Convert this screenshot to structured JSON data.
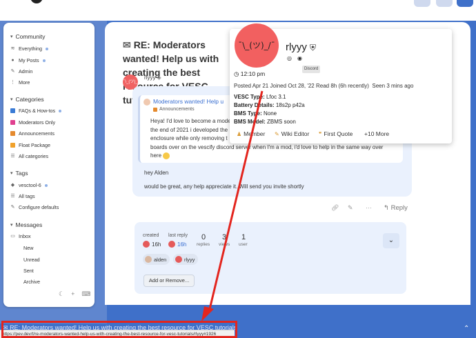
{
  "sidebar": {
    "community": {
      "heading": "Community",
      "items": [
        {
          "label": "Everything",
          "icon": "layers-icon",
          "dot": true
        },
        {
          "label": "My Posts",
          "icon": "user-icon",
          "dot": true
        },
        {
          "label": "Admin",
          "icon": "wrench-icon",
          "dot": false
        },
        {
          "label": "More",
          "icon": "ellipsis-icon",
          "dot": false
        }
      ]
    },
    "categories": {
      "heading": "Categories",
      "items": [
        {
          "label": "FAQs & How-tos",
          "color": "#3a7bd5",
          "dot": true
        },
        {
          "label": "Moderators Only",
          "color": "#e0408f",
          "dot": false
        },
        {
          "label": "Announcements",
          "color": "#e58a2e",
          "dot": false
        },
        {
          "label": "Float Package",
          "color": "#f0a12b",
          "dot": false
        },
        {
          "label": "All categories",
          "icon": "list-icon",
          "dot": false
        }
      ]
    },
    "tags": {
      "heading": "Tags",
      "items": [
        {
          "label": "vesctool-6",
          "icon": "tag-icon",
          "dot": true
        },
        {
          "label": "All tags",
          "icon": "list-icon",
          "dot": false
        },
        {
          "label": "Configure defaults",
          "icon": "wrench-icon",
          "dot": false
        }
      ]
    },
    "messages": {
      "heading": "Messages",
      "inbox": "Inbox",
      "sub_items": [
        "New",
        "Unread",
        "Sent",
        "Archive"
      ]
    }
  },
  "topic": {
    "title": "RE: Moderators wanted! Help us with creating the best resource for VESC tutorials"
  },
  "post": {
    "avatar_text": "¯\\_(ツ)_/¯",
    "username": "rlyyy",
    "quote_title": "Moderators wanted! Help u",
    "quote_category": "Announcements",
    "quote_lines": [
      "Heya! I'd love to become a moderator. Around",
      "the end of 2021 i developed the",
      "enclosure while only removing t",
      "boards over on the vescify discord server when I'm a mod, i'd love to help in the same way over",
      "here"
    ],
    "reply_line1": "hey Alden",
    "reply_line2": "would be great, any help appreciate it. Will send you invite shortly",
    "reply_label": "Reply"
  },
  "meta": {
    "created_label": "created",
    "created_value": "16h",
    "last_reply_label": "last reply",
    "last_reply_value": "16h",
    "replies_num": "0",
    "replies_label": "replies",
    "views_num": "3",
    "views_label": "views",
    "users_num": "1",
    "users_label": "user",
    "participants": [
      "alden",
      "rlyyy"
    ],
    "add_button": "Add or Remove..."
  },
  "profile_card": {
    "avatar_text": "¯\\_(ツ)_/¯",
    "name": "rlyyy",
    "badge": "Discord",
    "local_time": "12:10 pm",
    "posted_label": "Posted",
    "posted_value": "Apr 21",
    "joined_label": "Joined",
    "joined_value": "Oct 28, '22",
    "read_label": "Read",
    "read_value": "8h (6h recently)",
    "seen_label": "Seen",
    "seen_value": "3 mins ago",
    "fields": [
      {
        "label": "VESC Type:",
        "value": "Lfoc 3.1"
      },
      {
        "label": "Battery Details:",
        "value": "18s2p p42a"
      },
      {
        "label": "BMS Type:",
        "value": "None"
      },
      {
        "label": "BMS Model:",
        "value": "ZBMS soon"
      }
    ],
    "chips": [
      "Member",
      "Wiki Editor",
      "First Quote",
      "+10 More"
    ]
  },
  "footer": {
    "topic_title": "RE: Moderators wanted! Help us with creating the best resource for VESC tutorials",
    "status_url": "https://pev.dev/t/re-moderators-wanted-help-us-with-creating-the-best-resource-for-vesc-tutorials/rlyyy#1926"
  },
  "colors": {
    "accent_blue": "#3f70c9",
    "avatar_red": "#f26060",
    "highlight_red": "#e3251e"
  }
}
